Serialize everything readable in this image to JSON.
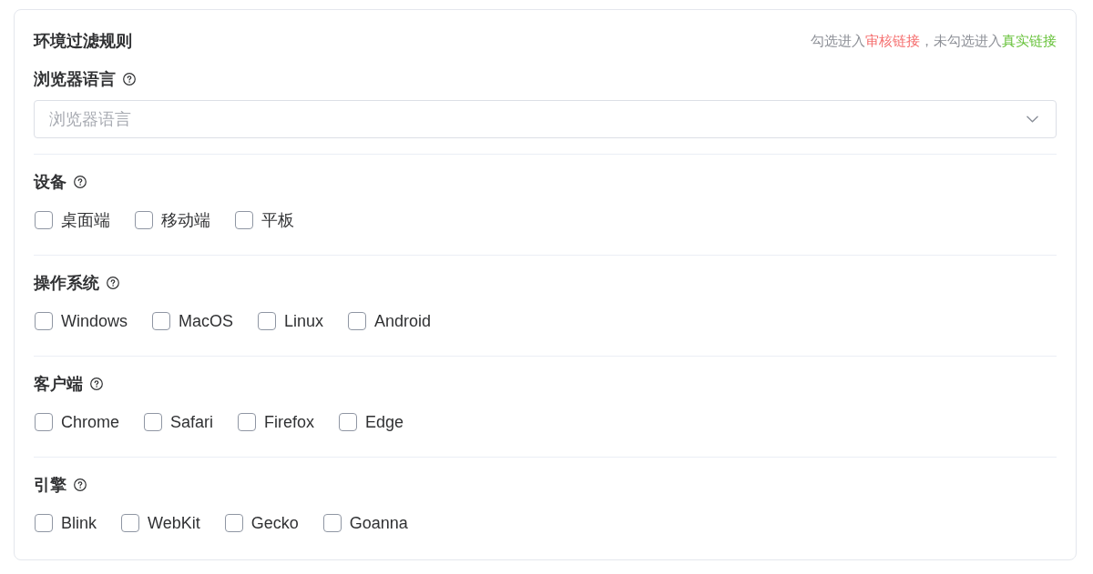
{
  "panel": {
    "title": "环境过滤规则",
    "hint": [
      {
        "text": "勾选进入",
        "color": "#8c8f96"
      },
      {
        "text": "审核链接",
        "color": "#f56c6c"
      },
      {
        "text": "，未勾选进入",
        "color": "#8c8f96"
      },
      {
        "text": "真实链接",
        "color": "#67c23a"
      }
    ]
  },
  "fields": [
    {
      "kind": "select",
      "label": "浏览器语言",
      "placeholder": "浏览器语言"
    },
    {
      "kind": "checkboxes",
      "label": "设备",
      "options": [
        {
          "label": "桌面端",
          "checked": false
        },
        {
          "label": "移动端",
          "checked": false
        },
        {
          "label": "平板",
          "checked": false
        }
      ]
    },
    {
      "kind": "checkboxes",
      "label": "操作系统",
      "options": [
        {
          "label": "Windows",
          "checked": false
        },
        {
          "label": "MacOS",
          "checked": false
        },
        {
          "label": "Linux",
          "checked": false
        },
        {
          "label": "Android",
          "checked": false
        }
      ]
    },
    {
      "kind": "checkboxes",
      "label": "客户端",
      "options": [
        {
          "label": "Chrome",
          "checked": false
        },
        {
          "label": "Safari",
          "checked": false
        },
        {
          "label": "Firefox",
          "checked": false
        },
        {
          "label": "Edge",
          "checked": false
        }
      ]
    },
    {
      "kind": "checkboxes",
      "label": "引擎",
      "options": [
        {
          "label": "Blink",
          "checked": false
        },
        {
          "label": "WebKit",
          "checked": false
        },
        {
          "label": "Gecko",
          "checked": false
        },
        {
          "label": "Goanna",
          "checked": false
        }
      ]
    }
  ]
}
